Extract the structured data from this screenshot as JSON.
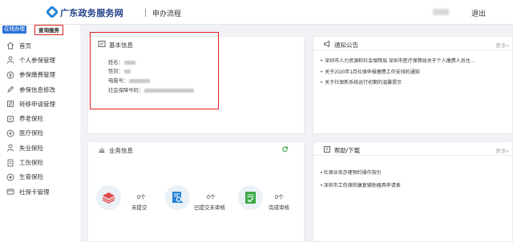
{
  "header": {
    "brand": "广东政务服务网",
    "nav_item": "申办流程",
    "logout": "退出"
  },
  "sidebar": {
    "tab_online": "在线办理",
    "tab_query": "查询服务",
    "items": [
      {
        "label": "首页",
        "icon": "home-icon"
      },
      {
        "label": "个人参保管理",
        "icon": "person-icon"
      },
      {
        "label": "参保缴费管理",
        "icon": "payment-icon"
      },
      {
        "label": "参保信息修改",
        "icon": "edit-icon"
      },
      {
        "label": "转移申请管理",
        "icon": "transfer-icon"
      },
      {
        "label": "养老保险",
        "icon": "pension-icon"
      },
      {
        "label": "医疗保险",
        "icon": "medical-icon"
      },
      {
        "label": "失业保险",
        "icon": "unemployment-icon"
      },
      {
        "label": "工伤保险",
        "icon": "injury-icon"
      },
      {
        "label": "生育保险",
        "icon": "maternity-icon"
      },
      {
        "label": "社保卡管理",
        "icon": "card-icon"
      }
    ]
  },
  "basic_info": {
    "title": "基本信息",
    "fields": [
      {
        "label": "姓名："
      },
      {
        "label": "性别："
      },
      {
        "label": "电脑号："
      },
      {
        "label": "社会保障号码："
      }
    ]
  },
  "notice": {
    "title": "通知公告",
    "more": "更多»",
    "items": [
      "深圳市人力资源和社会保障局 深圳市医疗保障局关于个人缴费人员住…",
      "关于2020年1月社保申报缴费工作安排的通知",
      "关于社保新系统运行初期的温馨提示"
    ]
  },
  "business": {
    "title": "业务信息",
    "stats": [
      {
        "count": "0个",
        "label": "未提交",
        "icon": "stack-icon",
        "color": "#e34a4a"
      },
      {
        "count": "0个",
        "label": "已提交未审核",
        "icon": "search-document-icon",
        "color": "#2a84d8"
      },
      {
        "count": "0个",
        "label": "完成审核",
        "icon": "checklist-icon",
        "color": "#3aa845"
      }
    ]
  },
  "help": {
    "title": "帮助/下载",
    "more": "更多»",
    "items": [
      "社保业务办理预约操作指引",
      "深圳市工伤保险康复辅助器具申请表"
    ]
  }
}
